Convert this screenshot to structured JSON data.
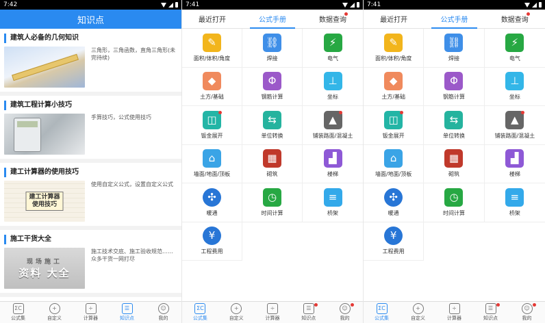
{
  "colors": {
    "accent": "#2a8af0",
    "badge": "#e53935"
  },
  "panel1": {
    "time": "7:42",
    "title": "知识点",
    "articles": [
      {
        "title": "建筑人必备的几何知识",
        "desc": "三角形，三角函数，直角三角形(未完待续)"
      },
      {
        "title": "建筑工程计算小技巧",
        "desc": "手算技巧，公式使用技巧"
      },
      {
        "title": "建工计算器的使用技巧",
        "desc": "使用自定义公式，设置自定义公式",
        "thumb_text": "建工计算器\n使用技巧"
      },
      {
        "title": "施工干货大全",
        "desc": "施工技术交底、施工验收规范……众多干货一网打尽",
        "thumb_text": "资料 大全",
        "thumb_small": "现场施工"
      },
      {
        "title": "...",
        "desc": ""
      }
    ]
  },
  "panel2": {
    "time": "7:41",
    "tabs": [
      "最近打开",
      "公式手册",
      "数据查询"
    ]
  },
  "panel3": {
    "time": "7:41",
    "tabs": [
      "最近打开",
      "公式手册",
      "数据查询"
    ]
  },
  "grid_items": [
    {
      "label": "面积/体积/角度",
      "icon": "ruler-pencil-icon",
      "color": "#f2b51c",
      "glyph": "✎"
    },
    {
      "label": "焊接",
      "icon": "link-icon",
      "color": "#3f8fe8",
      "glyph": "⛓"
    },
    {
      "label": "电气",
      "icon": "electric-plug-icon",
      "color": "#27a843",
      "glyph": "⚡"
    },
    {
      "label": "土方/基础",
      "icon": "earth-mound-icon",
      "color": "#f08a5d",
      "glyph": "◆"
    },
    {
      "label": "钢筋计算",
      "icon": "rebar-icon",
      "color": "#9b59c9",
      "glyph": "Φ"
    },
    {
      "label": "坐标",
      "icon": "coordinate-axes-icon",
      "color": "#33b6e8",
      "glyph": "⊥"
    },
    {
      "label": "钣金展开",
      "icon": "sheet-metal-icon",
      "color": "#23b5a6",
      "glyph": "◫",
      "dot": true
    },
    {
      "label": "单位转换",
      "icon": "swap-arrows-icon",
      "color": "#25b39e",
      "glyph": "⇆"
    },
    {
      "label": "铺装路面/混凝土",
      "icon": "road-icon",
      "color": "#666666",
      "glyph": "▲",
      "dot": true
    },
    {
      "label": "墙面/地面/顶板",
      "icon": "house-icon",
      "color": "#3aa4e6",
      "glyph": "⌂"
    },
    {
      "label": "砌筑",
      "icon": "brick-wall-icon",
      "color": "#c0392b",
      "glyph": "▦"
    },
    {
      "label": "楼梯",
      "icon": "stairs-vip-icon",
      "color": "#8e59d6",
      "glyph": "▟"
    },
    {
      "label": "暖通",
      "icon": "fan-icon",
      "color": "#2876d6",
      "glyph": "✣",
      "round": true
    },
    {
      "label": "时间计算",
      "icon": "calendar-clock-icon",
      "color": "#27a843",
      "glyph": "◷"
    },
    {
      "label": "桥架",
      "icon": "cable-tray-icon",
      "color": "#33a9ea",
      "glyph": "≡"
    },
    {
      "label": "工程费用",
      "icon": "cost-house-icon",
      "color": "#2876d6",
      "glyph": "¥",
      "round": true
    }
  ],
  "bottom_nav": [
    {
      "label": "公式集",
      "icon": "formula-set-icon",
      "glyph": "ΣC"
    },
    {
      "label": "自定义",
      "icon": "plus-circle-icon",
      "glyph": "+"
    },
    {
      "label": "计算器",
      "icon": "calculator-icon",
      "glyph": "÷"
    },
    {
      "label": "知识点",
      "icon": "book-icon",
      "glyph": "☰"
    },
    {
      "label": "我的",
      "icon": "user-icon",
      "glyph": "☺"
    }
  ]
}
